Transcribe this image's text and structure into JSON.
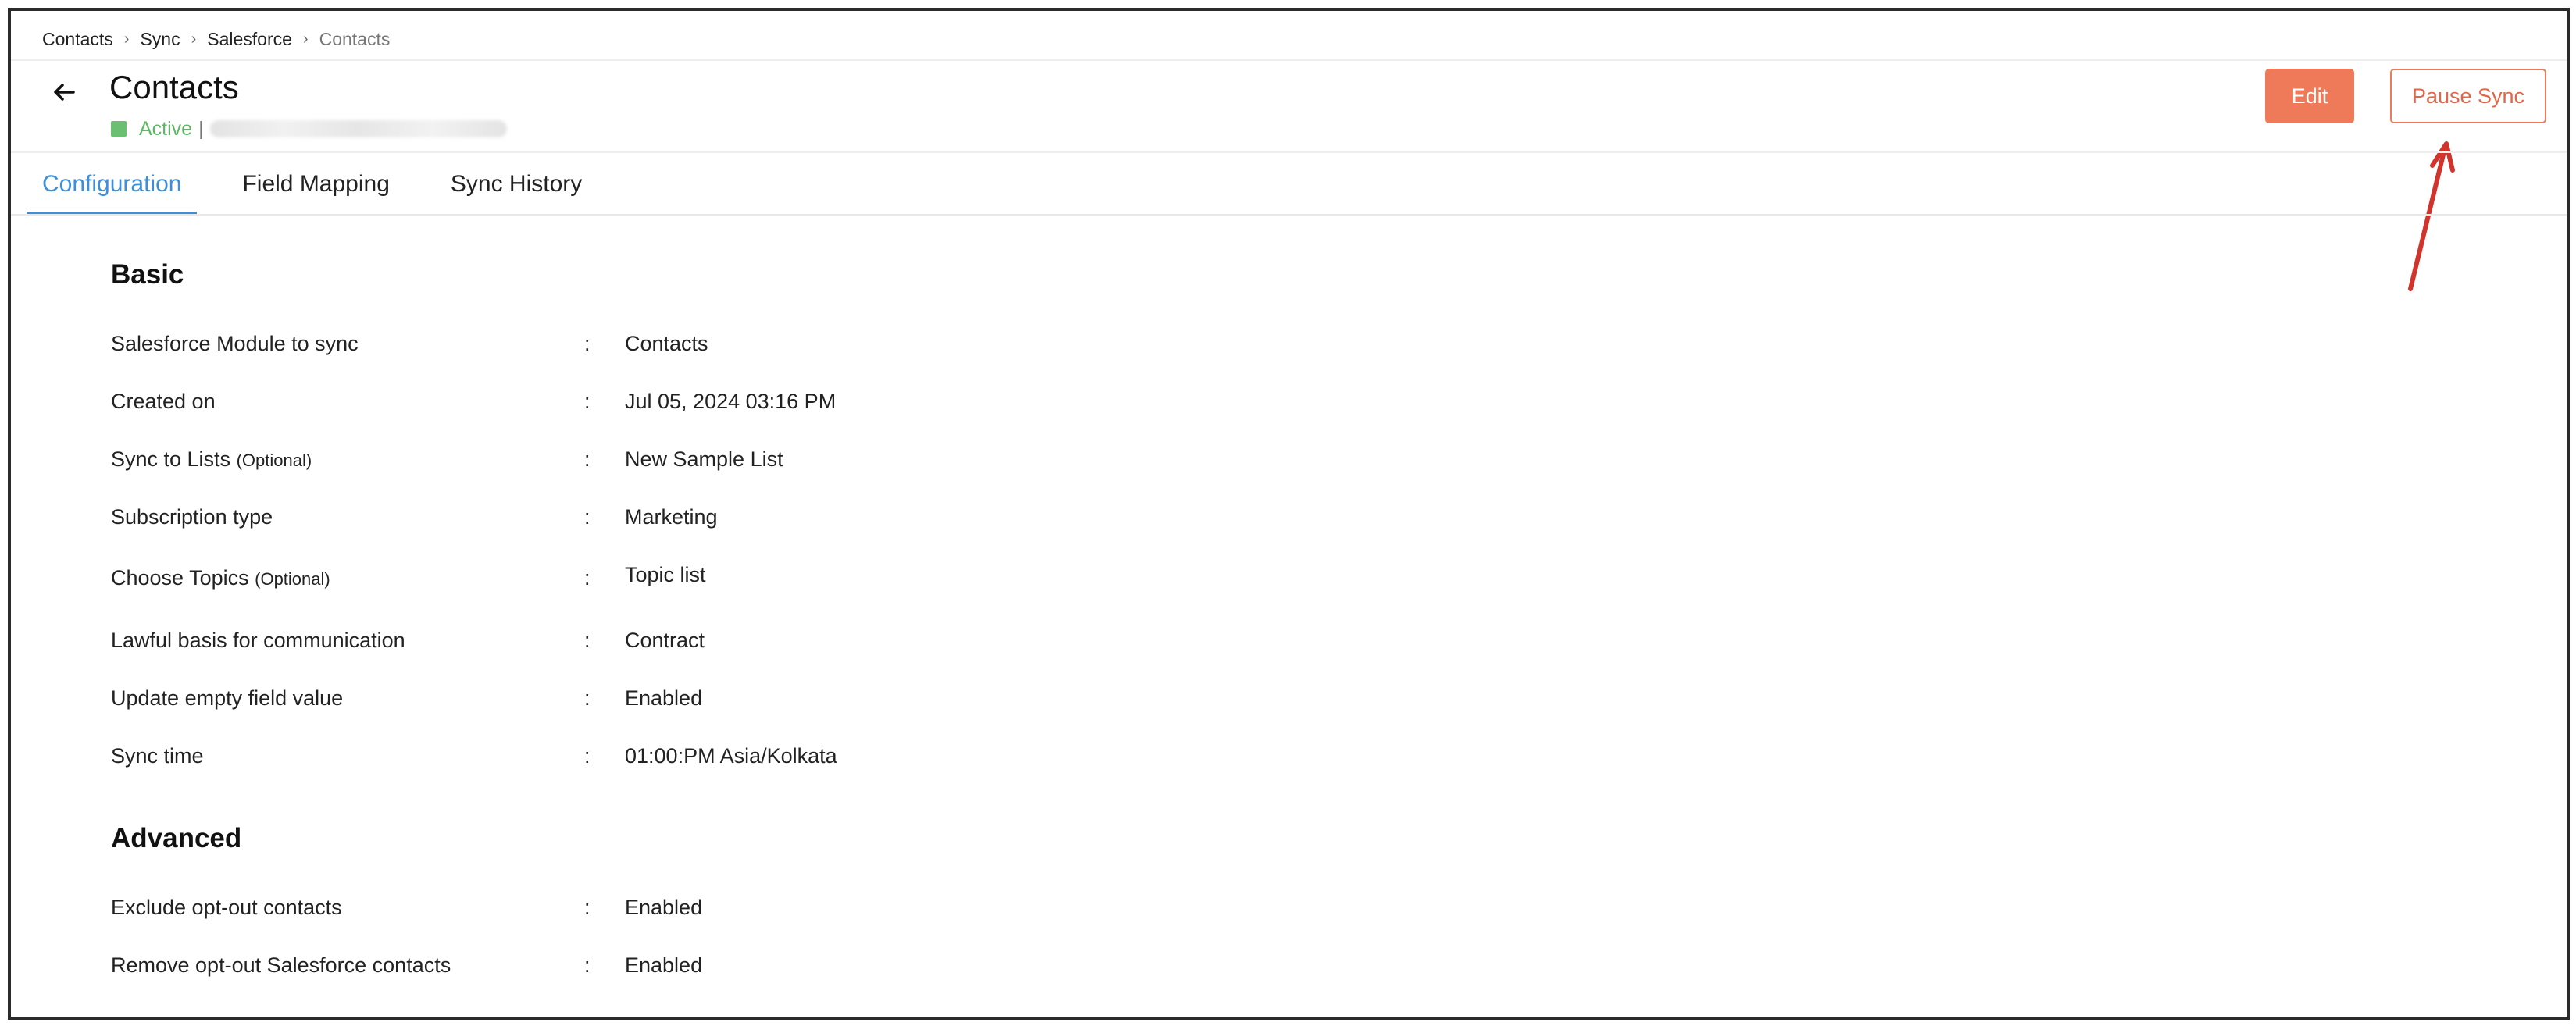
{
  "breadcrumb": {
    "items": [
      "Contacts",
      "Sync",
      "Salesforce"
    ],
    "current": "Contacts"
  },
  "header": {
    "title": "Contacts",
    "status": "Active",
    "status_separator": "|",
    "status_color": "#5db864"
  },
  "actions": {
    "edit_label": "Edit",
    "pause_label": "Pause Sync",
    "accent_color": "#ef7a5a"
  },
  "tabs": [
    {
      "label": "Configuration",
      "active": true
    },
    {
      "label": "Field Mapping",
      "active": false
    },
    {
      "label": "Sync History",
      "active": false
    }
  ],
  "basic": {
    "title": "Basic",
    "rows": [
      {
        "label": "Salesforce Module to sync",
        "optional": "",
        "value": "Contacts"
      },
      {
        "label": "Created on",
        "optional": "",
        "value": "Jul 05, 2024 03:16 PM"
      },
      {
        "label": "Sync to Lists",
        "optional": "(Optional)",
        "value": "New Sample List"
      },
      {
        "label": "Subscription type",
        "optional": "",
        "value": "Marketing"
      },
      {
        "label": "Choose Topics",
        "optional": "(Optional)",
        "value": "Topic list"
      },
      {
        "label": "Lawful basis for communication",
        "optional": "",
        "value": "Contract"
      },
      {
        "label": "Update empty field value",
        "optional": "",
        "value": "Enabled"
      },
      {
        "label": "Sync time",
        "optional": "",
        "value": "01:00:PM Asia/Kolkata"
      }
    ]
  },
  "advanced": {
    "title": "Advanced",
    "rows": [
      {
        "label": "Exclude opt-out contacts",
        "optional": "",
        "value": "Enabled"
      },
      {
        "label": "Remove opt-out Salesforce contacts",
        "optional": "",
        "value": "Enabled"
      }
    ]
  },
  "separator": ":",
  "icons": {
    "back": "arrow-left-icon",
    "breadcrumb_sep": "chevron-right-icon",
    "annotation": "red-arrow-annotation"
  }
}
